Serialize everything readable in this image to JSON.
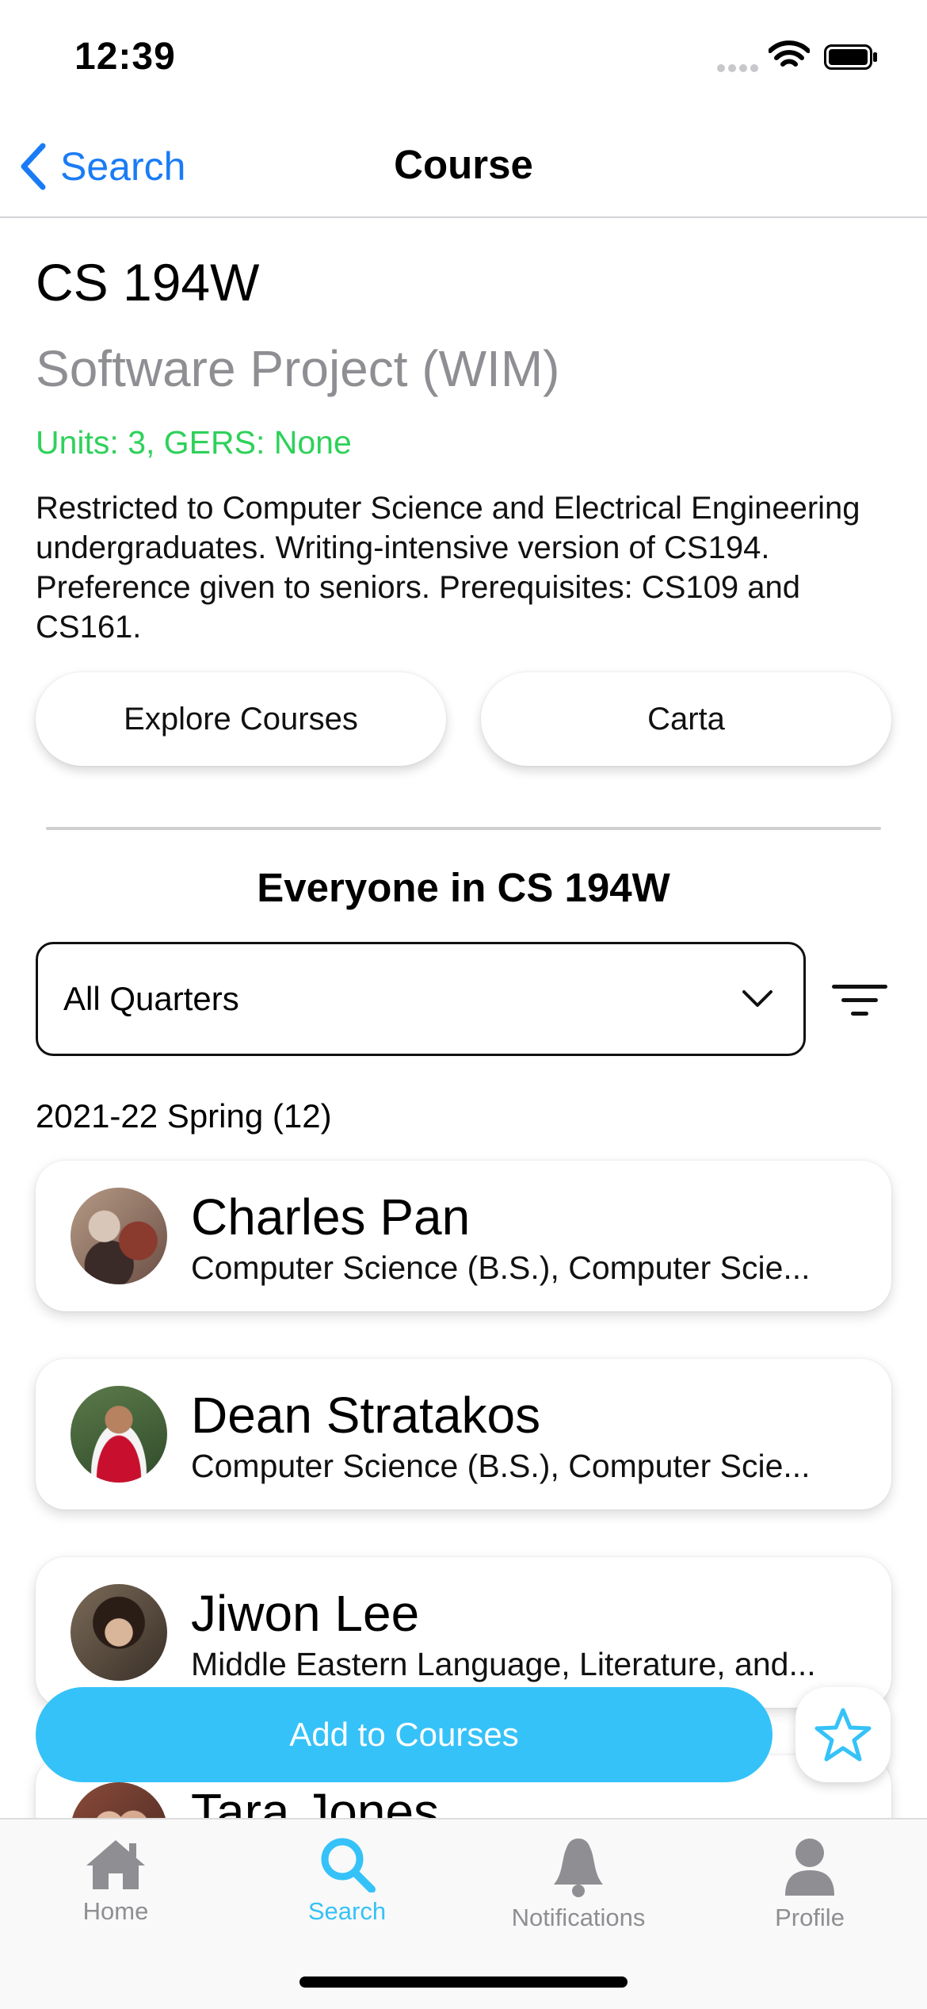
{
  "status_bar": {
    "time": "12:39"
  },
  "nav": {
    "back_label": "Search",
    "title": "Course"
  },
  "course": {
    "code": "CS 194W",
    "name": "Software Project (WIM)",
    "units_gers": "Units: 3, GERS: None",
    "description": "Restricted to Computer Science and Electrical Engineering undergraduates.  Writing-intensive version of CS194. Preference given to seniors. Prerequisites: CS109 and CS161."
  },
  "links": {
    "explore": "Explore Courses",
    "carta": "Carta"
  },
  "roster": {
    "title": "Everyone in CS 194W",
    "quarter_select": "All Quarters",
    "quarter_heading": "2021-22 Spring (12)",
    "people": [
      {
        "name": "Charles Pan",
        "major": "Computer Science (B.S.), Computer Scie..."
      },
      {
        "name": "Dean Stratakos",
        "major": "Computer Science (B.S.), Computer Scie..."
      },
      {
        "name": "Jiwon Lee",
        "major": "Middle Eastern Language, Literature, and..."
      },
      {
        "name": "Tara Jones",
        "major": ""
      }
    ]
  },
  "actions": {
    "add_to_courses": "Add to Courses",
    "favorite_icon": "star-icon"
  },
  "tabs": [
    {
      "label": "Home",
      "icon": "home-icon"
    },
    {
      "label": "Search",
      "icon": "search-icon"
    },
    {
      "label": "Notifications",
      "icon": "bell-icon"
    },
    {
      "label": "Profile",
      "icon": "person-icon"
    }
  ],
  "colors": {
    "accent": "#35c2f8",
    "link": "#1a7cf5",
    "units": "#2ed15a"
  }
}
